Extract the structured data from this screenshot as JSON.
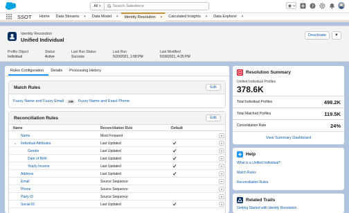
{
  "header": {
    "search_scope": "All",
    "search_placeholder": "Search Salesforce"
  },
  "nav": {
    "app_name": "SSOT",
    "items": [
      {
        "label": "Home",
        "has_menu": false
      },
      {
        "label": "Data Streams",
        "has_menu": true
      },
      {
        "label": "Data Model",
        "has_menu": true
      },
      {
        "label": "Identity Resolution",
        "has_menu": true
      },
      {
        "label": "Calculated Insights",
        "has_menu": true
      },
      {
        "label": "Data Explorer",
        "has_menu": true
      }
    ]
  },
  "record": {
    "object_type": "Identity Resolution",
    "title": "Unified Individual",
    "deactivate_label": "Deactivate",
    "fields": [
      {
        "label": "Profile Object",
        "value": "Individual"
      },
      {
        "label": "Status",
        "value": "Active"
      },
      {
        "label": "Last Run Status",
        "value": "Success"
      },
      {
        "label": "Last Run",
        "value": "5/20/2021, 1:58 PM"
      },
      {
        "label": "Last Modified",
        "value": "5/18/2021, 4:25 PM"
      }
    ]
  },
  "tabs": [
    "Rules Configuration",
    "Details",
    "Processing History"
  ],
  "match_rules": {
    "title": "Match Rules",
    "edit_label": "Edit",
    "rule1": "Fuzzy Name and Fuzzy Email",
    "or_label": "OR",
    "rule2": "Fuzzy Name and Exact Phone"
  },
  "reconciliation": {
    "title": "Reconciliation Rules",
    "edit_label": "Edit",
    "columns": [
      "Name",
      "Reconciliation Rule",
      "Default"
    ],
    "rows": [
      {
        "name": "Name",
        "rule": "Most Frequent",
        "default": false,
        "indent": 1,
        "expander": false
      },
      {
        "name": "Individual Attributes",
        "rule": "Last Updated",
        "default": true,
        "indent": 1,
        "expander": true
      },
      {
        "name": "Gender",
        "rule": "Last Updated",
        "default": true,
        "indent": 2,
        "expander": false
      },
      {
        "name": "Date of Birth",
        "rule": "Last Updated",
        "default": true,
        "indent": 2,
        "expander": false
      },
      {
        "name": "Yearly Income",
        "rule": "Last Updated",
        "default": true,
        "indent": 2,
        "expander": false
      },
      {
        "name": "Address",
        "rule": "Last Updated",
        "default": true,
        "indent": 1,
        "expander": false
      },
      {
        "name": "Email",
        "rule": "Source Sequence",
        "default": false,
        "indent": 1,
        "expander": false
      },
      {
        "name": "Phone",
        "rule": "Source Sequence",
        "default": false,
        "indent": 1,
        "expander": false
      },
      {
        "name": "Party ID",
        "rule": "Source Sequence",
        "default": false,
        "indent": 1,
        "expander": false
      },
      {
        "name": "Social ID",
        "rule": "Last Updated",
        "default": true,
        "indent": 1,
        "expander": false
      }
    ]
  },
  "summary": {
    "title": "Resolution Summary",
    "unified_label": "Unified Individual Profiles",
    "unified_value": "378.6K",
    "rows": [
      {
        "label": "Total Individual Profiles",
        "value": "498.2K"
      },
      {
        "label": "Total Matched Profiles",
        "value": "119.5K"
      },
      {
        "label": "Consolidation Rate",
        "value": "24%"
      }
    ],
    "view_dashboard": "View Summary Dashboard"
  },
  "help": {
    "title": "Help",
    "links": [
      "What is a Unified Individual?",
      "Match Rules",
      "Reconciliation Rules"
    ]
  },
  "trails": {
    "title": "Related Trails",
    "link": "Getting Started with Identity Resolution"
  },
  "colors": {
    "brand_blue": "#0b5cab",
    "summary_icon": "#ea001e",
    "help_icon": "#1b96ff",
    "trails_icon": "#032d60",
    "active_tab_accent": "#c98e3b"
  }
}
